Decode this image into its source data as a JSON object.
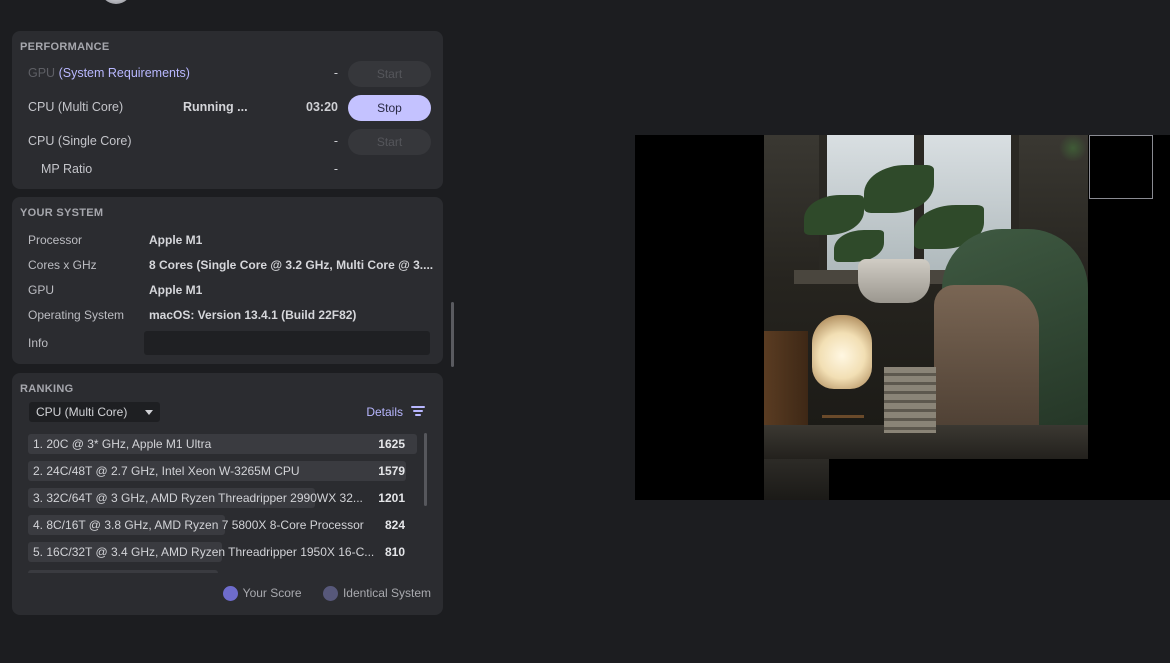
{
  "performance": {
    "title": "PERFORMANCE",
    "gpu": {
      "label": "GPU",
      "link": "(System Requirements)",
      "value": "-",
      "button": "Start"
    },
    "cpu_multi": {
      "label": "CPU (Multi Core)",
      "status": "Running ...",
      "time": "03:20",
      "button": "Stop"
    },
    "cpu_single": {
      "label": "CPU (Single Core)",
      "value": "-",
      "button": "Start"
    },
    "mp_ratio": {
      "label": "MP Ratio",
      "value": "-"
    }
  },
  "your_system": {
    "title": "YOUR SYSTEM",
    "rows": [
      {
        "key": "Processor",
        "value": "Apple M1"
      },
      {
        "key": "Cores x GHz",
        "value": "8 Cores (Single Core @ 3.2 GHz, Multi Core @ 3...."
      },
      {
        "key": "GPU",
        "value": "Apple M1"
      },
      {
        "key": "Operating System",
        "value": "macOS: Version 13.4.1 (Build 22F82)"
      }
    ],
    "info_label": "Info",
    "info_value": ""
  },
  "ranking": {
    "title": "RANKING",
    "selected": "CPU (Multi Core)",
    "details_label": "Details",
    "entries": [
      {
        "name": "1. 20C @ 3* GHz, Apple M1 Ultra",
        "score": "1625",
        "fraction": 1.0
      },
      {
        "name": "2. 24C/48T @ 2.7 GHz, Intel Xeon W-3265M CPU",
        "score": "1579",
        "fraction": 0.972
      },
      {
        "name": "3. 32C/64T @ 3 GHz, AMD Ryzen Threadripper 2990WX 32...",
        "score": "1201",
        "fraction": 0.739
      },
      {
        "name": "4. 8C/16T @ 3.8 GHz, AMD Ryzen 7 5800X 8-Core Processor",
        "score": "824",
        "fraction": 0.507
      },
      {
        "name": "5. 16C/32T @ 3.4 GHz, AMD Ryzen Threadripper 1950X 16-C...",
        "score": "810",
        "fraction": 0.498
      }
    ],
    "legend": {
      "your_score": "Your Score",
      "identical": "Identical System"
    }
  },
  "colors": {
    "accent": "#c4c2ff",
    "link": "#b9b8ff",
    "your_score_dot": "#6e6ccc",
    "identical_dot": "#57587a"
  }
}
